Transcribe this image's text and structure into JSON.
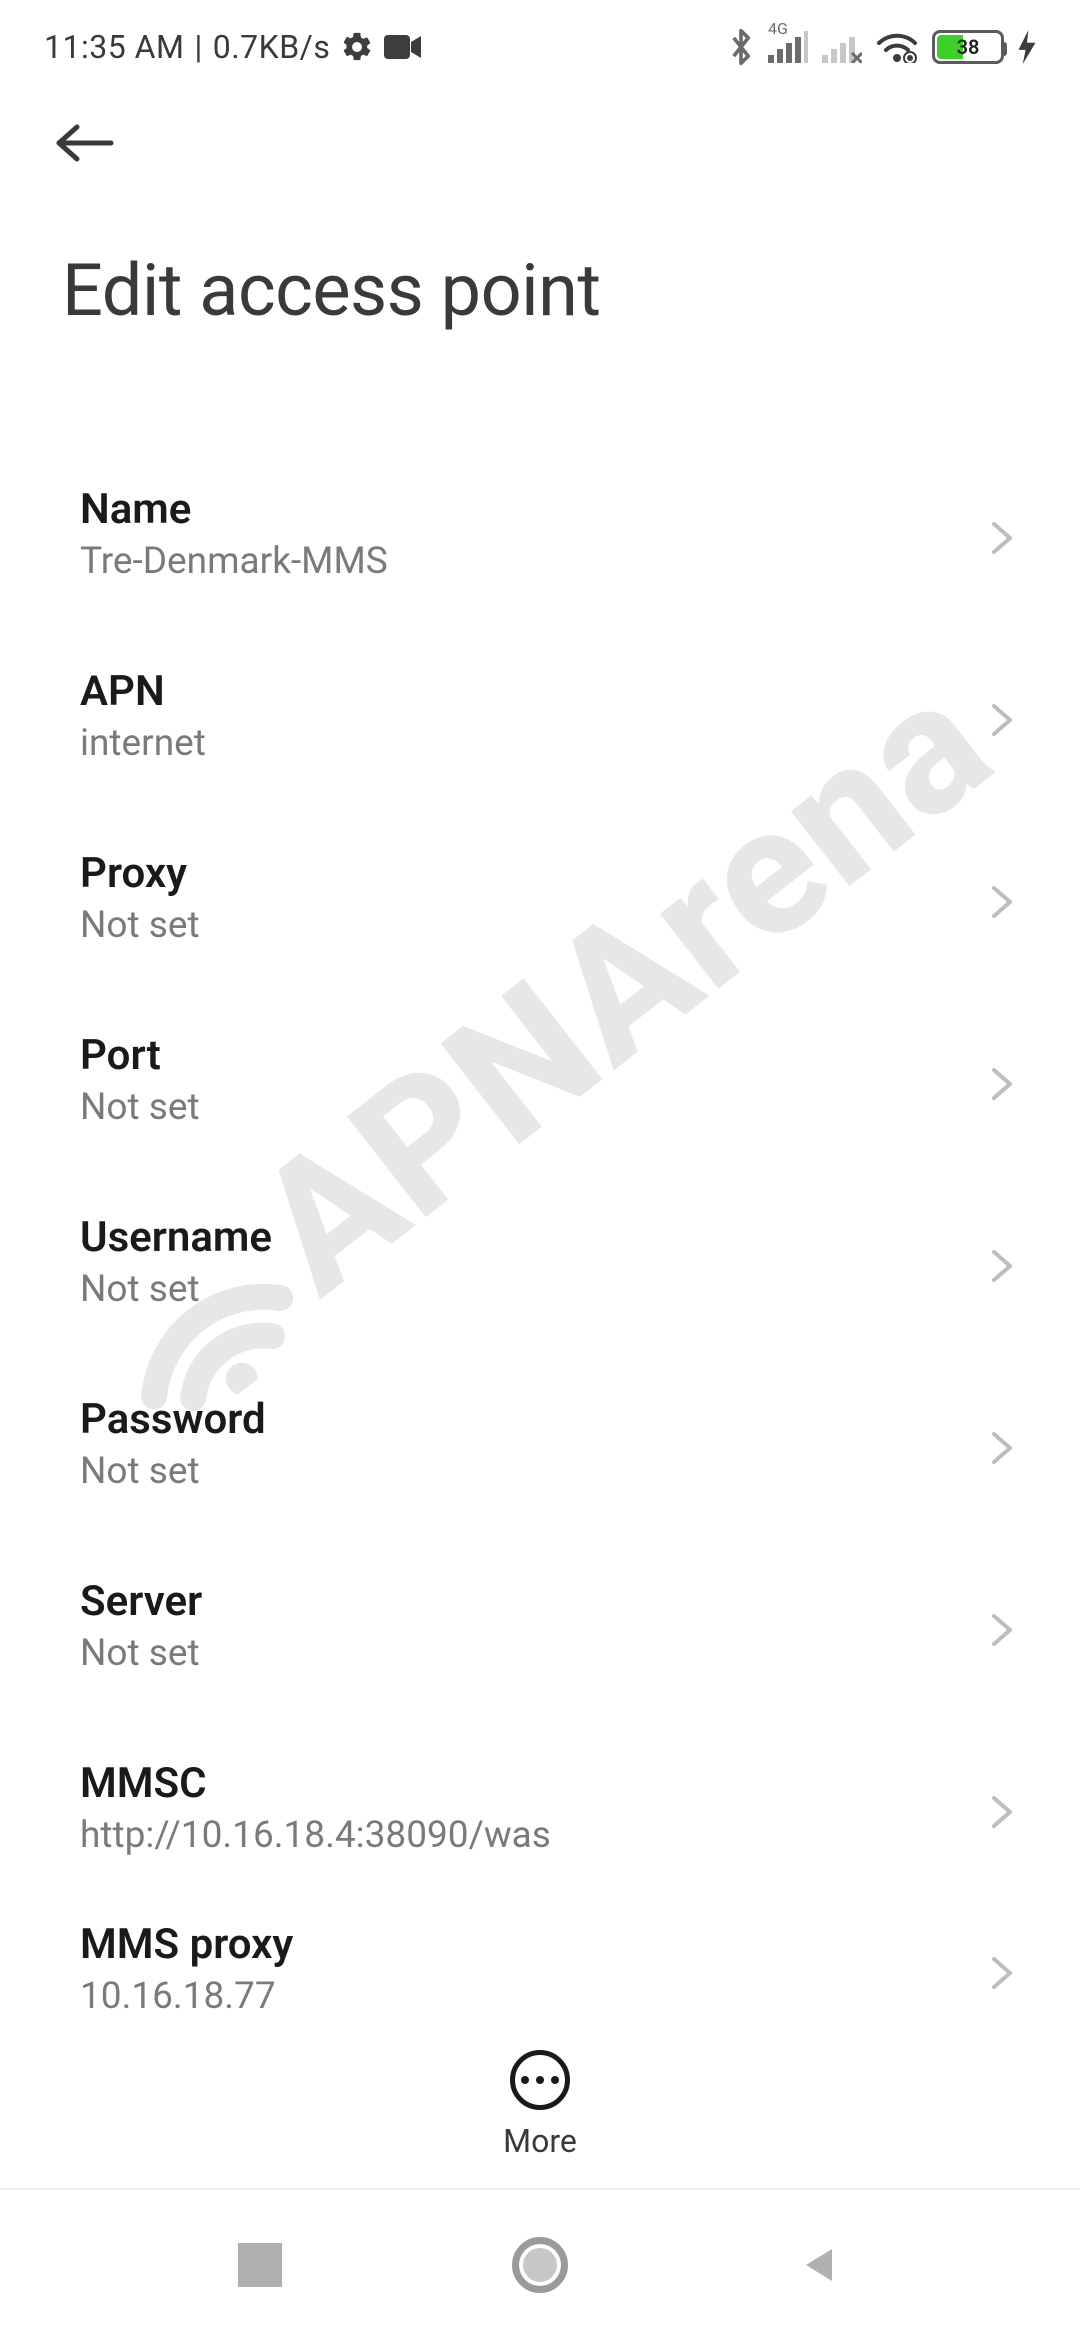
{
  "status": {
    "time": "11:35 AM",
    "divider": "|",
    "rate": "0.7KB/s",
    "network_label": "4G",
    "battery_percent": "38"
  },
  "header": {
    "title": "Edit access point"
  },
  "settings": [
    {
      "label": "Name",
      "value": "Tre-Denmark-MMS"
    },
    {
      "label": "APN",
      "value": "internet"
    },
    {
      "label": "Proxy",
      "value": "Not set"
    },
    {
      "label": "Port",
      "value": "Not set"
    },
    {
      "label": "Username",
      "value": "Not set"
    },
    {
      "label": "Password",
      "value": "Not set"
    },
    {
      "label": "Server",
      "value": "Not set"
    },
    {
      "label": "MMSC",
      "value": "http://10.16.18.4:38090/was"
    },
    {
      "label": "MMS proxy",
      "value": "10.16.18.77"
    }
  ],
  "more": {
    "label": "More"
  },
  "watermark": {
    "text": "APNArena"
  }
}
